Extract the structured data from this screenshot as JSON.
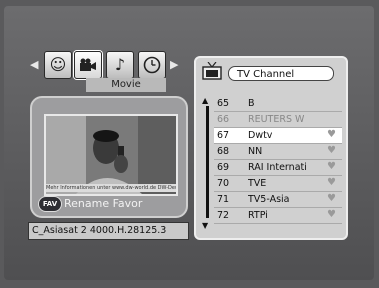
{
  "categories": {
    "icons": [
      "people-icon",
      "camera-icon",
      "music-icon",
      "clock-icon"
    ],
    "selected_index": 1,
    "selected_label": "Movie"
  },
  "preview": {
    "ticker_text": "Mehr Informationen unter www.dw-world.de DW-Deutsch",
    "fav_button": "FAV",
    "fav_label": "Rename Favor"
  },
  "transponder": {
    "info": "C_Asiasat 2  4000.H.28125.3"
  },
  "channel_list": {
    "title": "TV Channel",
    "rows": [
      {
        "number": "65",
        "name": "B",
        "dim": false,
        "fav": false,
        "selected": false
      },
      {
        "number": "66",
        "name": "REUTERS W",
        "dim": true,
        "fav": false,
        "selected": false
      },
      {
        "number": "67",
        "name": "Dwtv",
        "dim": false,
        "fav": true,
        "selected": true
      },
      {
        "number": "68",
        "name": "NN",
        "dim": false,
        "fav": true,
        "selected": false
      },
      {
        "number": "69",
        "name": "RAI Internati",
        "dim": false,
        "fav": true,
        "selected": false
      },
      {
        "number": "70",
        "name": "TVE",
        "dim": false,
        "fav": true,
        "selected": false
      },
      {
        "number": "71",
        "name": "TV5-Asia",
        "dim": false,
        "fav": true,
        "selected": false
      },
      {
        "number": "72",
        "name": "RTPi",
        "dim": false,
        "fav": true,
        "selected": false
      }
    ]
  }
}
